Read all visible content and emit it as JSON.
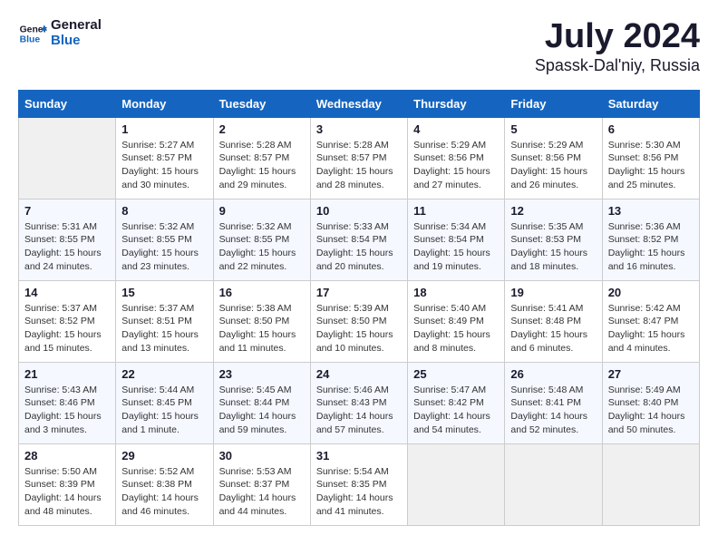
{
  "header": {
    "logo_line1": "General",
    "logo_line2": "Blue",
    "title": "July 2024",
    "subtitle": "Spassk-Dal'niy, Russia"
  },
  "weekdays": [
    "Sunday",
    "Monday",
    "Tuesday",
    "Wednesday",
    "Thursday",
    "Friday",
    "Saturday"
  ],
  "weeks": [
    [
      {
        "day": "",
        "info": ""
      },
      {
        "day": "1",
        "info": "Sunrise: 5:27 AM\nSunset: 8:57 PM\nDaylight: 15 hours\nand 30 minutes."
      },
      {
        "day": "2",
        "info": "Sunrise: 5:28 AM\nSunset: 8:57 PM\nDaylight: 15 hours\nand 29 minutes."
      },
      {
        "day": "3",
        "info": "Sunrise: 5:28 AM\nSunset: 8:57 PM\nDaylight: 15 hours\nand 28 minutes."
      },
      {
        "day": "4",
        "info": "Sunrise: 5:29 AM\nSunset: 8:56 PM\nDaylight: 15 hours\nand 27 minutes."
      },
      {
        "day": "5",
        "info": "Sunrise: 5:29 AM\nSunset: 8:56 PM\nDaylight: 15 hours\nand 26 minutes."
      },
      {
        "day": "6",
        "info": "Sunrise: 5:30 AM\nSunset: 8:56 PM\nDaylight: 15 hours\nand 25 minutes."
      }
    ],
    [
      {
        "day": "7",
        "info": "Sunrise: 5:31 AM\nSunset: 8:55 PM\nDaylight: 15 hours\nand 24 minutes."
      },
      {
        "day": "8",
        "info": "Sunrise: 5:32 AM\nSunset: 8:55 PM\nDaylight: 15 hours\nand 23 minutes."
      },
      {
        "day": "9",
        "info": "Sunrise: 5:32 AM\nSunset: 8:55 PM\nDaylight: 15 hours\nand 22 minutes."
      },
      {
        "day": "10",
        "info": "Sunrise: 5:33 AM\nSunset: 8:54 PM\nDaylight: 15 hours\nand 20 minutes."
      },
      {
        "day": "11",
        "info": "Sunrise: 5:34 AM\nSunset: 8:54 PM\nDaylight: 15 hours\nand 19 minutes."
      },
      {
        "day": "12",
        "info": "Sunrise: 5:35 AM\nSunset: 8:53 PM\nDaylight: 15 hours\nand 18 minutes."
      },
      {
        "day": "13",
        "info": "Sunrise: 5:36 AM\nSunset: 8:52 PM\nDaylight: 15 hours\nand 16 minutes."
      }
    ],
    [
      {
        "day": "14",
        "info": "Sunrise: 5:37 AM\nSunset: 8:52 PM\nDaylight: 15 hours\nand 15 minutes."
      },
      {
        "day": "15",
        "info": "Sunrise: 5:37 AM\nSunset: 8:51 PM\nDaylight: 15 hours\nand 13 minutes."
      },
      {
        "day": "16",
        "info": "Sunrise: 5:38 AM\nSunset: 8:50 PM\nDaylight: 15 hours\nand 11 minutes."
      },
      {
        "day": "17",
        "info": "Sunrise: 5:39 AM\nSunset: 8:50 PM\nDaylight: 15 hours\nand 10 minutes."
      },
      {
        "day": "18",
        "info": "Sunrise: 5:40 AM\nSunset: 8:49 PM\nDaylight: 15 hours\nand 8 minutes."
      },
      {
        "day": "19",
        "info": "Sunrise: 5:41 AM\nSunset: 8:48 PM\nDaylight: 15 hours\nand 6 minutes."
      },
      {
        "day": "20",
        "info": "Sunrise: 5:42 AM\nSunset: 8:47 PM\nDaylight: 15 hours\nand 4 minutes."
      }
    ],
    [
      {
        "day": "21",
        "info": "Sunrise: 5:43 AM\nSunset: 8:46 PM\nDaylight: 15 hours\nand 3 minutes."
      },
      {
        "day": "22",
        "info": "Sunrise: 5:44 AM\nSunset: 8:45 PM\nDaylight: 15 hours\nand 1 minute."
      },
      {
        "day": "23",
        "info": "Sunrise: 5:45 AM\nSunset: 8:44 PM\nDaylight: 14 hours\nand 59 minutes."
      },
      {
        "day": "24",
        "info": "Sunrise: 5:46 AM\nSunset: 8:43 PM\nDaylight: 14 hours\nand 57 minutes."
      },
      {
        "day": "25",
        "info": "Sunrise: 5:47 AM\nSunset: 8:42 PM\nDaylight: 14 hours\nand 54 minutes."
      },
      {
        "day": "26",
        "info": "Sunrise: 5:48 AM\nSunset: 8:41 PM\nDaylight: 14 hours\nand 52 minutes."
      },
      {
        "day": "27",
        "info": "Sunrise: 5:49 AM\nSunset: 8:40 PM\nDaylight: 14 hours\nand 50 minutes."
      }
    ],
    [
      {
        "day": "28",
        "info": "Sunrise: 5:50 AM\nSunset: 8:39 PM\nDaylight: 14 hours\nand 48 minutes."
      },
      {
        "day": "29",
        "info": "Sunrise: 5:52 AM\nSunset: 8:38 PM\nDaylight: 14 hours\nand 46 minutes."
      },
      {
        "day": "30",
        "info": "Sunrise: 5:53 AM\nSunset: 8:37 PM\nDaylight: 14 hours\nand 44 minutes."
      },
      {
        "day": "31",
        "info": "Sunrise: 5:54 AM\nSunset: 8:35 PM\nDaylight: 14 hours\nand 41 minutes."
      },
      {
        "day": "",
        "info": ""
      },
      {
        "day": "",
        "info": ""
      },
      {
        "day": "",
        "info": ""
      }
    ]
  ]
}
